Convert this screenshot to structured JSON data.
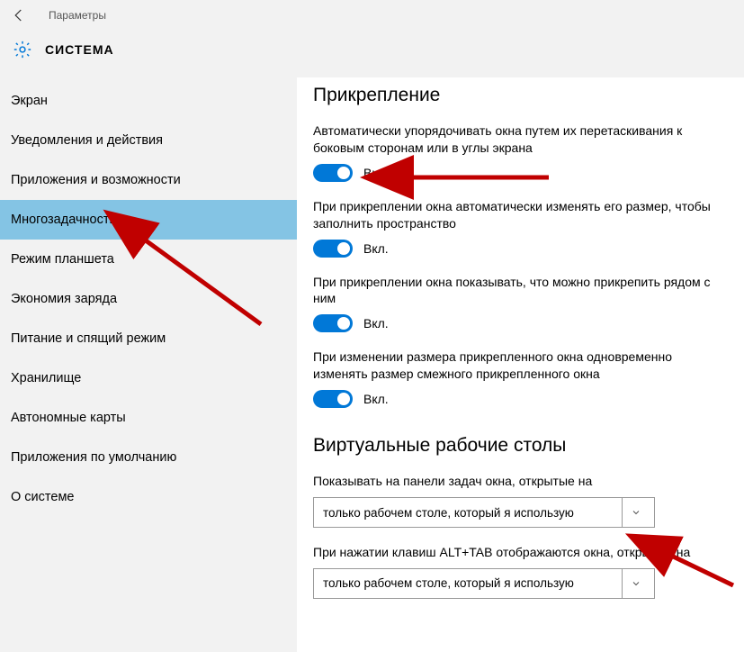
{
  "titlebar": {
    "title": "Параметры"
  },
  "header": {
    "title": "СИСТЕМА"
  },
  "sidebar": {
    "items": [
      {
        "label": "Экран"
      },
      {
        "label": "Уведомления и действия"
      },
      {
        "label": "Приложения и возможности"
      },
      {
        "label": "Многозадачность",
        "selected": true
      },
      {
        "label": "Режим планшета"
      },
      {
        "label": "Экономия заряда"
      },
      {
        "label": "Питание и спящий режим"
      },
      {
        "label": "Хранилище"
      },
      {
        "label": "Автономные карты"
      },
      {
        "label": "Приложения по умолчанию"
      },
      {
        "label": "О системе"
      }
    ]
  },
  "content": {
    "snap": {
      "title": "Прикрепление",
      "settings": [
        {
          "desc": "Автоматически упорядочивать окна путем их перетаскивания к боковым сторонам или в углы экрана",
          "state": "Вкл."
        },
        {
          "desc": "При прикреплении окна автоматически изменять его размер, чтобы заполнить пространство",
          "state": "Вкл."
        },
        {
          "desc": "При прикреплении окна показывать, что можно прикрепить рядом с ним",
          "state": "Вкл."
        },
        {
          "desc": "При изменении размера прикрепленного окна одновременно изменять размер смежного прикрепленного окна",
          "state": "Вкл."
        }
      ]
    },
    "vdesktops": {
      "title": "Виртуальные рабочие столы",
      "taskbar_label": "Показывать на панели задач окна, открытые на",
      "taskbar_value": "только рабочем столе, который я использую",
      "alttab_label": "При нажатии клавиш ALT+TAB отображаются окна, открытые на",
      "alttab_value": "только рабочем столе, который я использую"
    }
  }
}
